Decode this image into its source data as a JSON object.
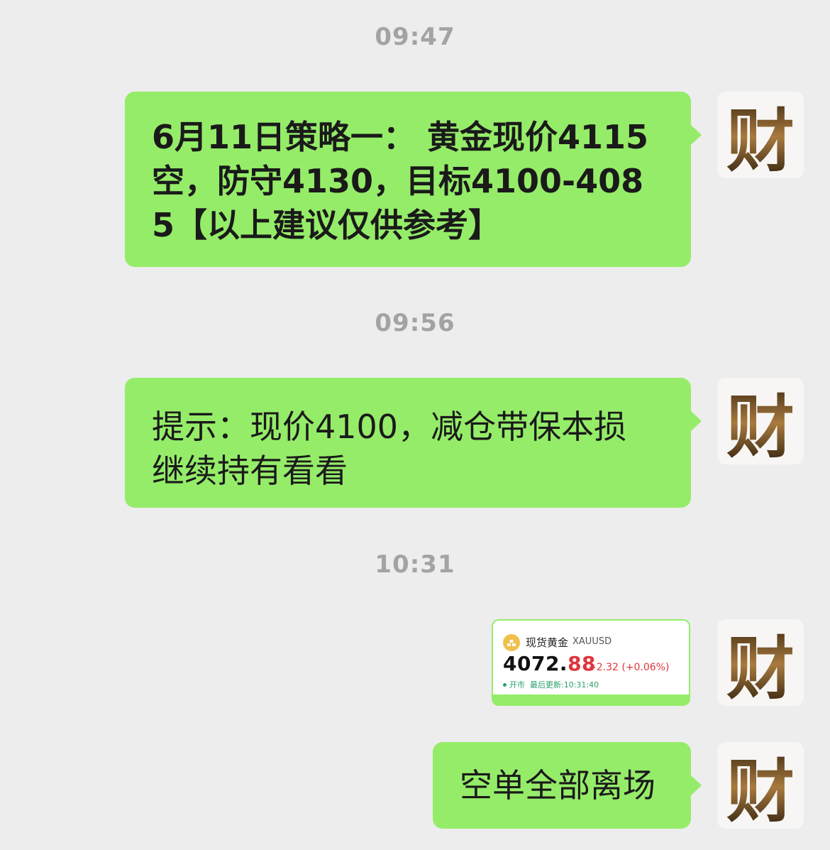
{
  "timestamps": [
    "09:47",
    "09:56",
    "10:31"
  ],
  "messages": {
    "m1": {
      "line1": "6月11日策略一： 黄金现价4115",
      "line2": "空，防守4130，目标4100-408",
      "line3": "5【以上建议仅供参考】"
    },
    "m2": {
      "line1": "提示：现价4100，减仓带保本损",
      "line2": "继续持有看看"
    },
    "m3": {
      "text": "空单全部离场"
    }
  },
  "quote_card": {
    "title": "现货黄金",
    "symbol": "XAUUSD",
    "price_int": "4072.",
    "price_dec": "88",
    "change": "+2.32 (+0.06%)",
    "status": "开市",
    "updated": "最后更新:10:31:40"
  },
  "avatar": {
    "glyph": "财",
    "icon": "calligraphy-avatar-icon"
  },
  "colors": {
    "background": "#ededed",
    "bubble": "#95ec69",
    "timestamp": "#a3a3a3",
    "price_red": "#e0353c",
    "status_green": "#28a06a"
  }
}
